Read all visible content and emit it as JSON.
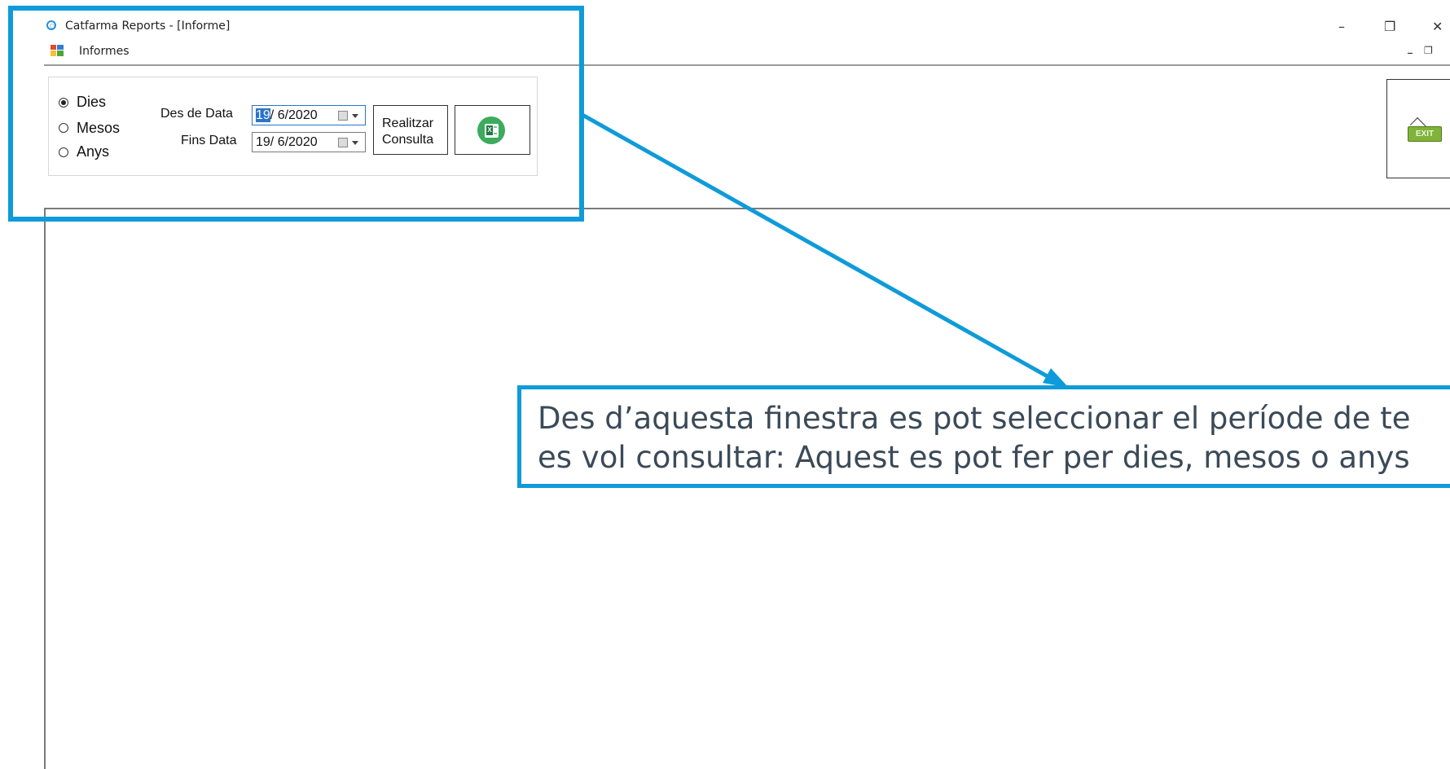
{
  "window": {
    "title": "Catfarma Reports - [Informe]",
    "minimize": "–",
    "restore": "❐",
    "close": "✕"
  },
  "menu": {
    "informes_label": "Informes",
    "mdi_minimize": "_",
    "mdi_restore": "❐"
  },
  "filters": {
    "period_options": [
      {
        "label": "Dies",
        "checked": true
      },
      {
        "label": "Mesos",
        "checked": false
      },
      {
        "label": "Anys",
        "checked": false
      }
    ],
    "from_label": "Des de Data",
    "to_label": "Fins Data",
    "from_value_selected": "19",
    "from_value_rest": "/ 6/2020",
    "to_value": "19/ 6/2020",
    "query_button": "Realitzar\nConsulta",
    "excel_icon": "excel-icon"
  },
  "exit": {
    "label": "EXIT",
    "icon": "exit-sign-icon"
  },
  "annotation": {
    "line1": "Des d’aquesta finestra es pot seleccionar el període de te",
    "line2": "es vol consultar: Aquest es pot fer per dies, mesos o anys",
    "accent_color": "#0f9bd9"
  }
}
